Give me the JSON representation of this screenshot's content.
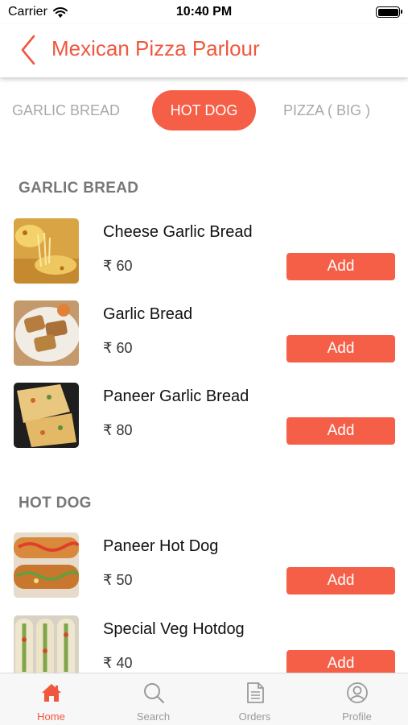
{
  "status_bar": {
    "carrier": "Carrier",
    "time": "10:40 PM"
  },
  "header": {
    "title": "Mexican Pizza Parlour",
    "back_icon": "chevron-left-icon"
  },
  "category_tabs": [
    {
      "label": "GARLIC BREAD",
      "active": false
    },
    {
      "label": "HOT DOG",
      "active": true
    },
    {
      "label": "PIZZA ( BIG )",
      "active": false
    }
  ],
  "sections": [
    {
      "title": "GARLIC BREAD",
      "items": [
        {
          "name": "Cheese Garlic Bread",
          "price": "₹ 60",
          "add_label": "Add"
        },
        {
          "name": "Garlic Bread",
          "price": "₹ 60",
          "add_label": "Add"
        },
        {
          "name": "Paneer Garlic Bread",
          "price": "₹ 80",
          "add_label": "Add"
        }
      ]
    },
    {
      "title": "HOT DOG",
      "items": [
        {
          "name": "Paneer Hot Dog",
          "price": "₹ 50",
          "add_label": "Add"
        },
        {
          "name": "Special Veg Hotdog",
          "price": "₹ 40",
          "add_label": "Add"
        }
      ]
    }
  ],
  "tab_bar": [
    {
      "label": "Home",
      "icon": "home-icon",
      "active": true
    },
    {
      "label": "Search",
      "icon": "search-icon",
      "active": false
    },
    {
      "label": "Orders",
      "icon": "document-icon",
      "active": false
    },
    {
      "label": "Profile",
      "icon": "user-icon",
      "active": false
    }
  ],
  "colors": {
    "accent": "#f55f47",
    "title": "#f0573f",
    "inactive": "#9a9a9a"
  }
}
